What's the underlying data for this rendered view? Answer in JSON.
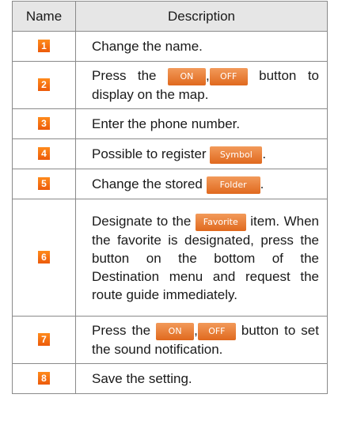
{
  "header": {
    "name": "Name",
    "description": "Description"
  },
  "rows": [
    {
      "num": "1",
      "desc": "Change the name."
    },
    {
      "num": "2",
      "pre": "Press the",
      "btn1": "ON",
      "sep": ",",
      "btn2": "OFF",
      "post": "button to display on the map."
    },
    {
      "num": "3",
      "desc": "Enter the phone number."
    },
    {
      "num": "4",
      "pre": "Possible to register",
      "btn": "Symbol",
      "post": "."
    },
    {
      "num": "5",
      "pre": "Change the stored",
      "btn": "Folder",
      "post": "."
    },
    {
      "num": "6",
      "pre": "Designate to the",
      "btn": "Favorite",
      "post": "item. When the favorite is designated, press the button on the bottom of the Destination menu and request the route guide immediately."
    },
    {
      "num": "7",
      "pre": "Press the",
      "btn1": "ON",
      "sep": ",",
      "btn2": "OFF",
      "post": "button to set the sound notification."
    },
    {
      "num": "8",
      "desc": "Save the setting."
    }
  ],
  "colors": {
    "badge": "#f07010",
    "button": "#e8782f",
    "header_bg": "#e6e6e6",
    "border": "#8a8a8a"
  }
}
